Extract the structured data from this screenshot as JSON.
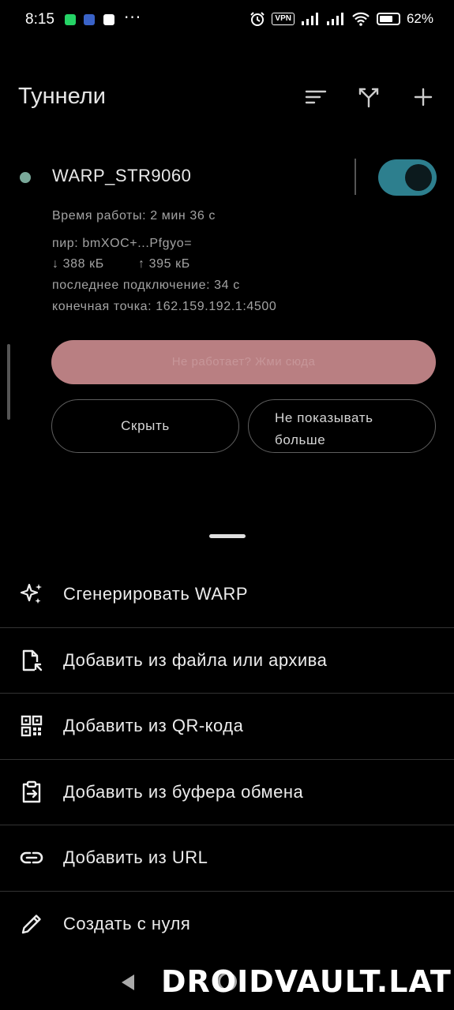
{
  "status_bar": {
    "time": "8:15",
    "dots": "···",
    "vpn": "VPN",
    "battery_pct": "62%",
    "battery_level": 0.62,
    "icons": [
      "whatsapp-icon",
      "app-icon",
      "app-icon",
      "alarm-icon",
      "signal-icon",
      "signal-icon",
      "wifi-icon",
      "battery-icon"
    ]
  },
  "header": {
    "title": "Туннели",
    "icons": [
      "sort-icon",
      "split-icon",
      "add-icon"
    ]
  },
  "tunnel": {
    "name": "WARP_STR9060",
    "uptime": "Время работы: 2 мин 36 с",
    "peer": "пир: bmXOC+...Pfgyo=",
    "rx": "↓ 388 кБ",
    "tx": "↑ 395 кБ",
    "handshake": "последнее подключение: 34 с",
    "endpoint": "конечная точка: 162.159.192.1:4500",
    "enabled": true,
    "accent": "#2d7f8e",
    "status_color": "#7aa99a"
  },
  "buttons": {
    "not_working": "Не работает? Жми сюда",
    "hide": "Скрыть",
    "never_show_1": "Не показывать",
    "never_show_2": "больше"
  },
  "menu": {
    "items": [
      {
        "label": "Сгенерировать WARP",
        "icon": "sparkle-icon"
      },
      {
        "label": "Добавить из файла или архива",
        "icon": "file-icon"
      },
      {
        "label": "Добавить из QR-кода",
        "icon": "qr-code-icon"
      },
      {
        "label": "Добавить из буфера обмена",
        "icon": "clipboard-icon"
      },
      {
        "label": "Добавить из URL",
        "icon": "link-icon"
      },
      {
        "label": "Создать с нуля",
        "icon": "pencil-icon"
      }
    ]
  },
  "watermark": "DROIDVAULT.LAT"
}
